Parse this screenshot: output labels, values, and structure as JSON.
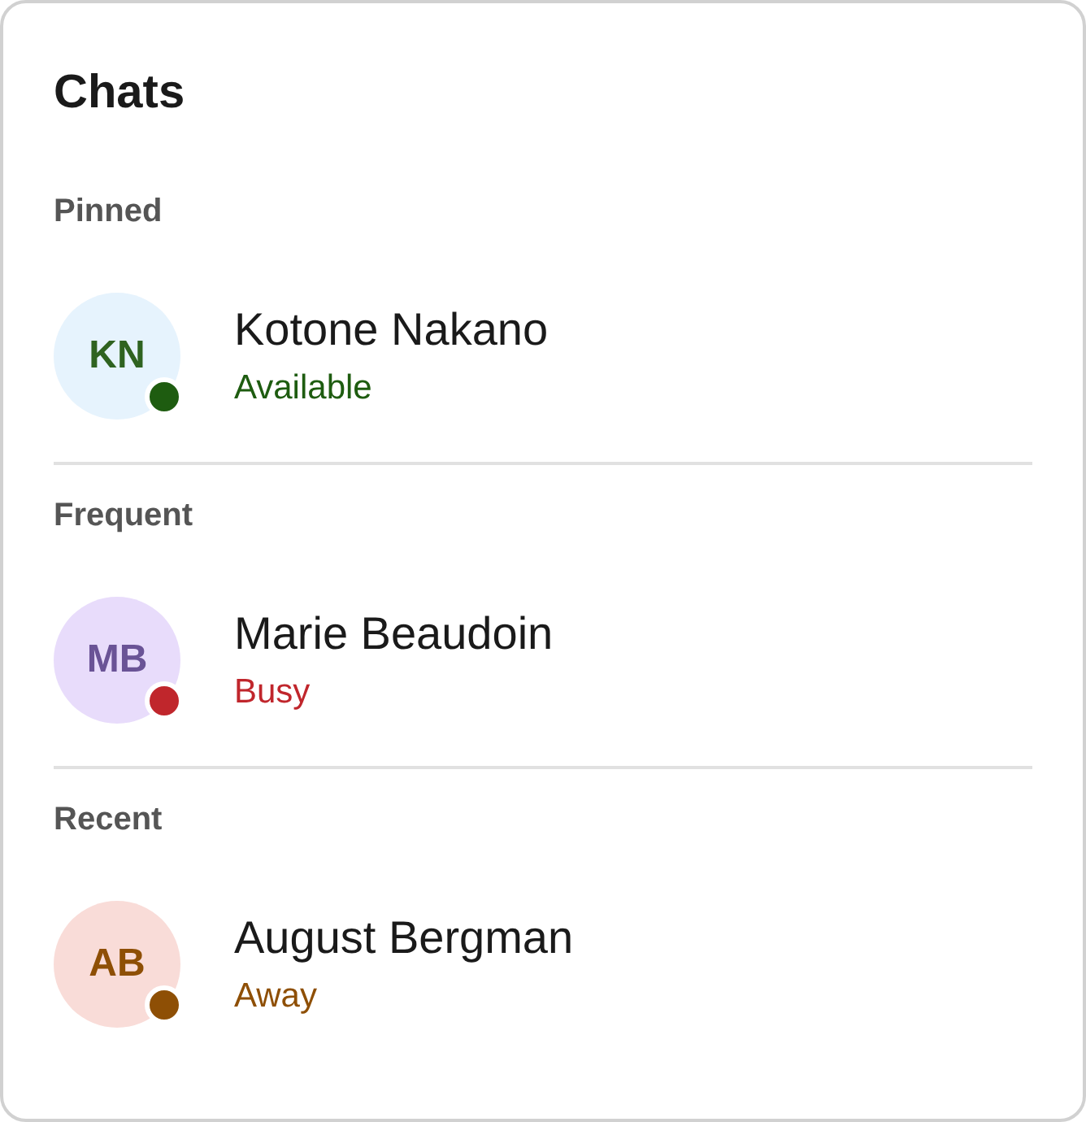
{
  "title": "Chats",
  "sections": [
    {
      "label": "Pinned",
      "contacts": [
        {
          "initials": "KN",
          "name": "Kotone Nakano",
          "status": "Available",
          "color": "#1e5c10"
        }
      ]
    },
    {
      "label": "Frequent",
      "contacts": [
        {
          "initials": "MB",
          "name": "Marie Beaudoin",
          "status": "Busy",
          "color": "#c0262c"
        }
      ]
    },
    {
      "label": "Recent",
      "contacts": [
        {
          "initials": "AB",
          "name": "August Bergman",
          "status": "Away",
          "color": "#8e4f05"
        }
      ]
    }
  ]
}
